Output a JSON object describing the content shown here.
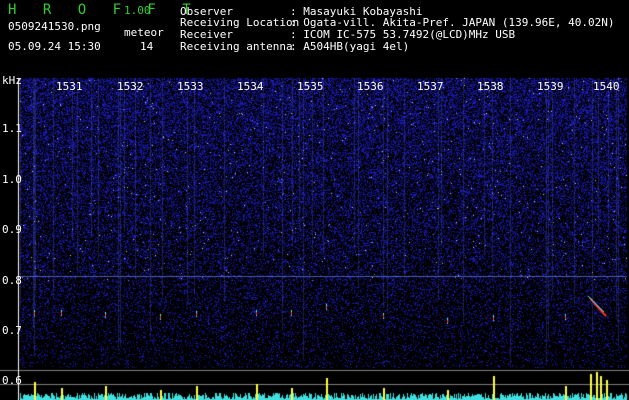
{
  "header": {
    "app_title": "H R O F F T",
    "version": "1.00",
    "filename": "0509241530.png",
    "datetime": "05.09.24 15:30",
    "meteor_label": "meteor",
    "meteor_count": "14"
  },
  "info": [
    {
      "label": "Observer",
      "value": ": Masayuki Kobayashi"
    },
    {
      "label": "Receiving Location",
      "value": ": Ogata-vill. Akita-Pref. JAPAN (139.96E, 40.02N)"
    },
    {
      "label": "Receiver",
      "value": ": ICOM IC-575 53.7492(@LCD)MHz USB"
    },
    {
      "label": "Receiving antenna",
      "value": ": A504HB(yagi 4el)"
    }
  ],
  "axis": {
    "unit": "kHz",
    "y_ticks": [
      "1.1",
      "1.0",
      "0.9",
      "0.8",
      "0.7",
      "0.6"
    ],
    "x_ticks": [
      "1531",
      "1532",
      "1533",
      "1534",
      "1535",
      "1536",
      "1537",
      "1538",
      "1539",
      "1540"
    ]
  },
  "colors": {
    "background": "#000000",
    "noise_blue": "#1a1aa0",
    "title_green": "#33cc33",
    "meteor_red": "#ff3030",
    "meteor_cyan": "#40ffff",
    "bar_cyan": "#40e0e0",
    "bar_yellow": "#ffff40"
  }
}
